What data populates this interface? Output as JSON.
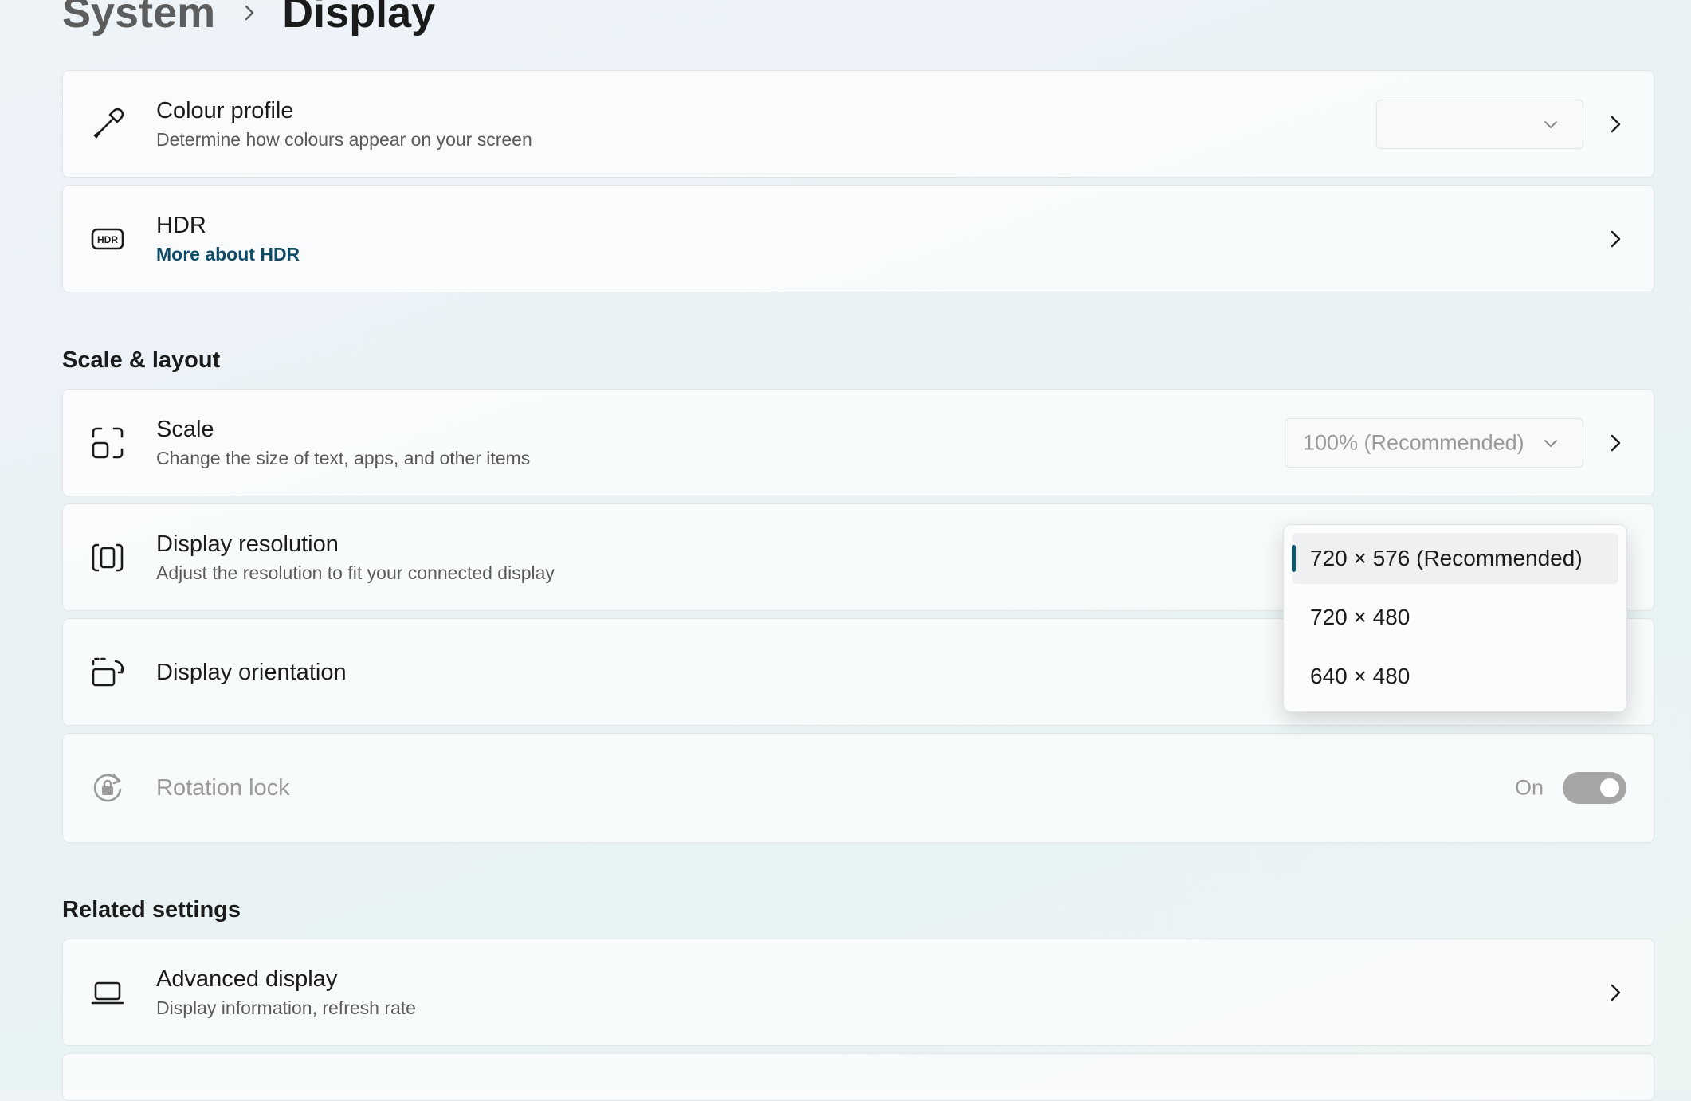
{
  "breadcrumb": {
    "parent": "System",
    "current": "Display"
  },
  "cards": {
    "colour_profile": {
      "title": "Colour profile",
      "subtitle": "Determine how colours appear on your screen",
      "icon": "eyedropper-icon"
    },
    "hdr": {
      "title": "HDR",
      "link": "More about HDR",
      "icon": "hdr-icon"
    },
    "scale": {
      "title": "Scale",
      "subtitle": "Change the size of text, apps, and other items",
      "value": "100% (Recommended)",
      "icon": "scale-icon"
    },
    "display_resolution": {
      "title": "Display resolution",
      "subtitle": "Adjust the resolution to fit your connected display",
      "icon": "resolution-icon"
    },
    "display_orientation": {
      "title": "Display orientation",
      "icon": "orientation-icon"
    },
    "rotation_lock": {
      "title": "Rotation lock",
      "state_label": "On",
      "icon": "rotation-lock-icon"
    },
    "advanced_display": {
      "title": "Advanced display",
      "subtitle": "Display information, refresh rate",
      "icon": "laptop-icon"
    }
  },
  "sections": {
    "scale_layout": "Scale & layout",
    "related_settings": "Related settings"
  },
  "resolution_dropdown": {
    "options": [
      "720 × 576 (Recommended)",
      "720 × 480",
      "640 × 480"
    ],
    "selected": "720 × 576 (Recommended)"
  },
  "colors": {
    "accent": "#0f5a73",
    "link": "#0f4b66",
    "toggle_disabled": "#a6a6a6"
  }
}
